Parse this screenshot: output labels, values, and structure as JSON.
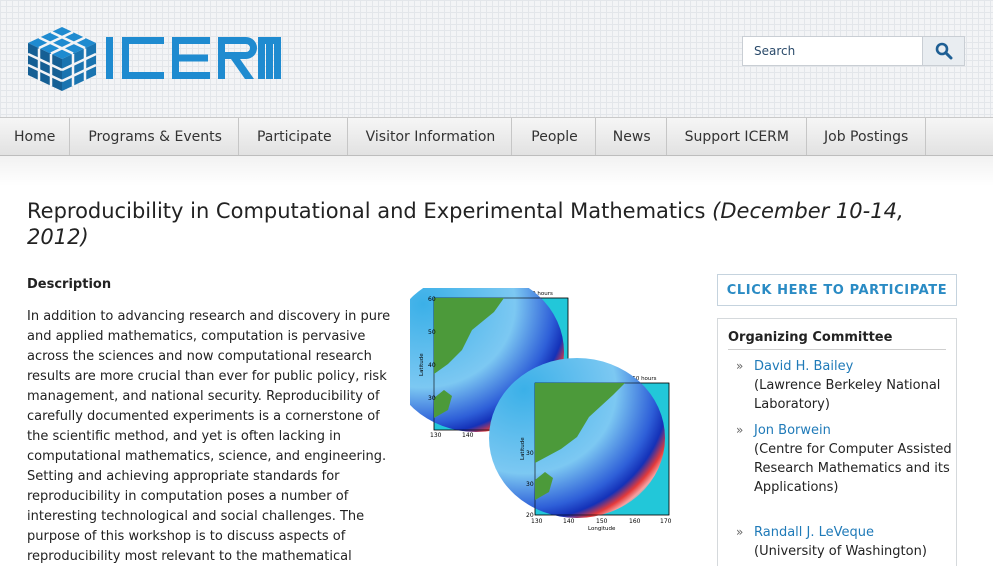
{
  "header": {
    "logo_text": "ICERM",
    "search": {
      "placeholder": "Search",
      "button_icon": "search-icon"
    },
    "colors": {
      "logo_blue": "#1f8bd0",
      "logo_dark": "#14507d"
    }
  },
  "nav": {
    "items": [
      {
        "label": "Home"
      },
      {
        "label": "Programs & Events"
      },
      {
        "label": "Participate"
      },
      {
        "label": "Visitor Information"
      },
      {
        "label": "People"
      },
      {
        "label": "News"
      },
      {
        "label": "Support ICERM"
      },
      {
        "label": "Job Postings"
      }
    ]
  },
  "page": {
    "title": "Reproducibility in Computational and Experimental Mathematics",
    "dates": "(December 10-14, 2012)",
    "description_heading": "Description",
    "description": "In addition to advancing research and discovery in pure and applied mathematics, computation is pervasive across the sciences and now computational research results are more crucial than ever for public policy, risk management, and national security. Reproducibility of carefully documented experiments is a cornerstone of the scientific method, and yet is often lacking in computational mathematics, science, and engineering. Setting and achieving appropriate standards for reproducibility in computation poses a number of interesting technological and social challenges. The purpose of this workshop is to discuss aspects of reproducibility most relevant to the mathematical"
  },
  "figure": {
    "plot_title_1": "Tsunami of 11 March 2011, at 2.50 hours",
    "plot_title_2": "of 11 March 2011, at 2.50 hours",
    "xlabel": "Longitude",
    "ylabel": "Latitude",
    "x_ticks": [
      "130",
      "140",
      "150",
      "160",
      "170"
    ],
    "y_ticks": [
      "20",
      "30",
      "40",
      "50",
      "60"
    ]
  },
  "sidebar": {
    "participate_label": "CLICK HERE TO PARTICIPATE",
    "committee_title": "Organizing Committee",
    "members": [
      {
        "name": "David H. Bailey",
        "affiliation": "(Lawrence Berkeley National Laboratory)"
      },
      {
        "name": "Jon Borwein",
        "affiliation": "(Centre for Computer Assisted Research Mathematics and its Applications)"
      },
      {
        "name": "Randall J. LeVeque",
        "affiliation": "(University of Washington)"
      }
    ]
  }
}
